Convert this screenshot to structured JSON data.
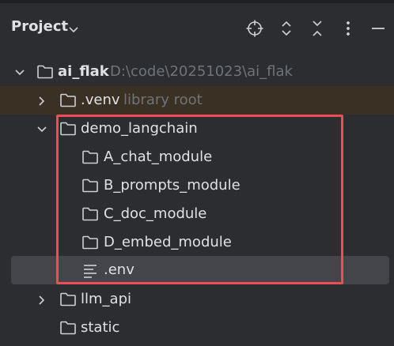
{
  "header": {
    "title": "Project",
    "icons": [
      "locate-icon",
      "expand-collapse-icon",
      "collapse-all-icon",
      "more-options-icon",
      "minimize-icon"
    ]
  },
  "tree": {
    "root": {
      "name": "ai_flak",
      "path": "D:\\code\\20251023\\ai_flak"
    },
    "venv": {
      "name": ".venv",
      "hint": "library root"
    },
    "demo": {
      "name": "demo_langchain"
    },
    "children": [
      "A_chat_module",
      "B_prompts_module",
      "C_doc_module",
      "D_embed_module"
    ],
    "env": {
      "name": ".env"
    },
    "llm_api": {
      "name": "llm_api"
    },
    "static": {
      "name": "static"
    }
  },
  "colors": {
    "background": "#2b2d30",
    "text": "#dfe1e5",
    "hint": "#6f737a",
    "highlight": "#ee4c56",
    "selection": "#43454a",
    "library_row": "#3a3124"
  }
}
